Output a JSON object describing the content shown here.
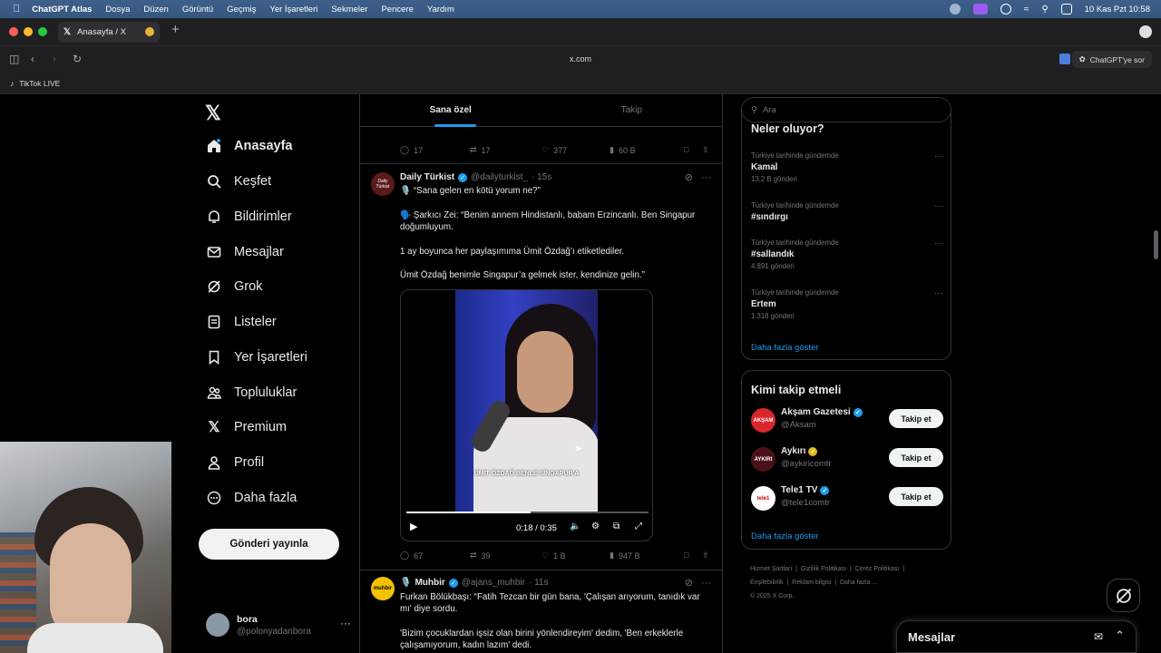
{
  "menubar": {
    "app": "ChatGPT Atlas",
    "menus": [
      "Dosya",
      "Düzen",
      "Görüntü",
      "Geçmiş",
      "Yer İşaretleri",
      "Sekmeler",
      "Pencere",
      "Yardım"
    ],
    "clock": "10 Kas Pzt  10:58"
  },
  "tabbar": {
    "tab_title": "Anasayfa / X"
  },
  "addressbar": {
    "url": "x.com",
    "ask_label": "ChatGPT'ye sor"
  },
  "bookmarks": {
    "items": [
      "TikTok LIVE"
    ]
  },
  "nav": {
    "items": [
      {
        "label": "Anasayfa",
        "icon": "home-icon"
      },
      {
        "label": "Keşfet",
        "icon": "search-icon"
      },
      {
        "label": "Bildirimler",
        "icon": "bell-icon"
      },
      {
        "label": "Mesajlar",
        "icon": "mail-icon"
      },
      {
        "label": "Grok",
        "icon": "grok-icon"
      },
      {
        "label": "Listeler",
        "icon": "list-icon"
      },
      {
        "label": "Yer İşaretleri",
        "icon": "bookmark-icon"
      },
      {
        "label": "Topluluklar",
        "icon": "communities-icon"
      },
      {
        "label": "Premium",
        "icon": "x-icon"
      },
      {
        "label": "Profil",
        "icon": "person-icon"
      },
      {
        "label": "Daha fazla",
        "icon": "more-circle-icon"
      }
    ],
    "post_button": "Gönderi yayınla",
    "user": {
      "name": "bora",
      "handle": "@polonyadanbora"
    }
  },
  "feed": {
    "tabs": [
      "Sana özel",
      "Takip"
    ],
    "prev_actions": {
      "replies": "17",
      "reposts": "17",
      "likes": "377",
      "views": "60 B"
    },
    "tweet1": {
      "name": "Daily Türkist",
      "handle": "@dailyturkist_",
      "time": "· 15s",
      "avatar_text": "Daily Türkist",
      "lines": [
        "🎙️ “Sana gelen en kötü yorum ne?”",
        "🗣️ Şarkıcı Zei: “Benim annem Hindistanlı, babam Erzincanlı. Ben Singapur doğumluyum.",
        "1 ay boyunca her paylaşımıma Ümit Özdağ’ı etiketlediler.",
        "Ümit Özdağ benimle Singapur’a gelmek ister, kendinize gelin.”"
      ],
      "video_caption": "ÜMİT ÖZDAĞ BENLE SİNGAPUR'A",
      "video_time": "0:18 / 0:35",
      "video_progress": 0.514,
      "actions": {
        "replies": "67",
        "reposts": "39",
        "likes": "1 B",
        "views": "947 B"
      }
    },
    "tweet2": {
      "name": "Muhbir",
      "handle": "@ajans_muhbir",
      "time": "· 11s",
      "avatar_text": "muhbir",
      "lines": [
        "Furkan Bölükbaşı: “Fatih Tezcan bir gün bana, 'Çalışan arıyorum, tanıdık var mı' diye sordu.",
        "'Bizim çocuklardan işsiz olan birini yönlendireyim' dedim, 'Ben erkeklerle çalışamıyorum, kadın lazım' dedi."
      ]
    }
  },
  "sidebar": {
    "search_placeholder": "Ara",
    "trends_title": "Neler oluyor?",
    "trends": [
      {
        "context": "Türkiye tarihinde gündemde",
        "title": "Kamal",
        "count": "13,2 B gönderi"
      },
      {
        "context": "Türkiye tarihinde gündemde",
        "title": "#sındırgı",
        "count": ""
      },
      {
        "context": "Türkiye tarihinde gündemde",
        "title": "#sallandık",
        "count": "4.891 gönderi"
      },
      {
        "context": "Türkiye tarihinde gündemde",
        "title": "Ertem",
        "count": "1.318 gönderi"
      }
    ],
    "show_more": "Daha fazla göster",
    "follow_title": "Kimi takip etmeli",
    "follow": [
      {
        "name": "Akşam Gazetesi",
        "handle": "@Aksam",
        "avatar_text": "AKŞAM",
        "avatar_color": "#d9262c",
        "badge_color": "#1d9bf0"
      },
      {
        "name": "Aykırı",
        "handle": "@aykiricomtr",
        "avatar_text": "AYKIRI",
        "avatar_color": "#4a1218",
        "badge_color": "#e2b719"
      },
      {
        "name": "Tele1 TV",
        "handle": "@tele1comtr",
        "avatar_text": "tele1",
        "avatar_color": "#ffffff",
        "badge_color": "#1d9bf0"
      }
    ],
    "follow_button": "Takip et",
    "footer": [
      "Hizmet Şartları",
      "Gizlilik Politikası",
      "Çerez Politikası",
      "Erişilebilirlik",
      "Reklam bilgisi",
      "Daha fazla ...",
      "© 2025 X Corp."
    ]
  },
  "messages_dock": {
    "title": "Mesajlar"
  },
  "colors": {
    "accent": "#1d9bf0",
    "bg": "#000000",
    "muted": "#71767b"
  }
}
